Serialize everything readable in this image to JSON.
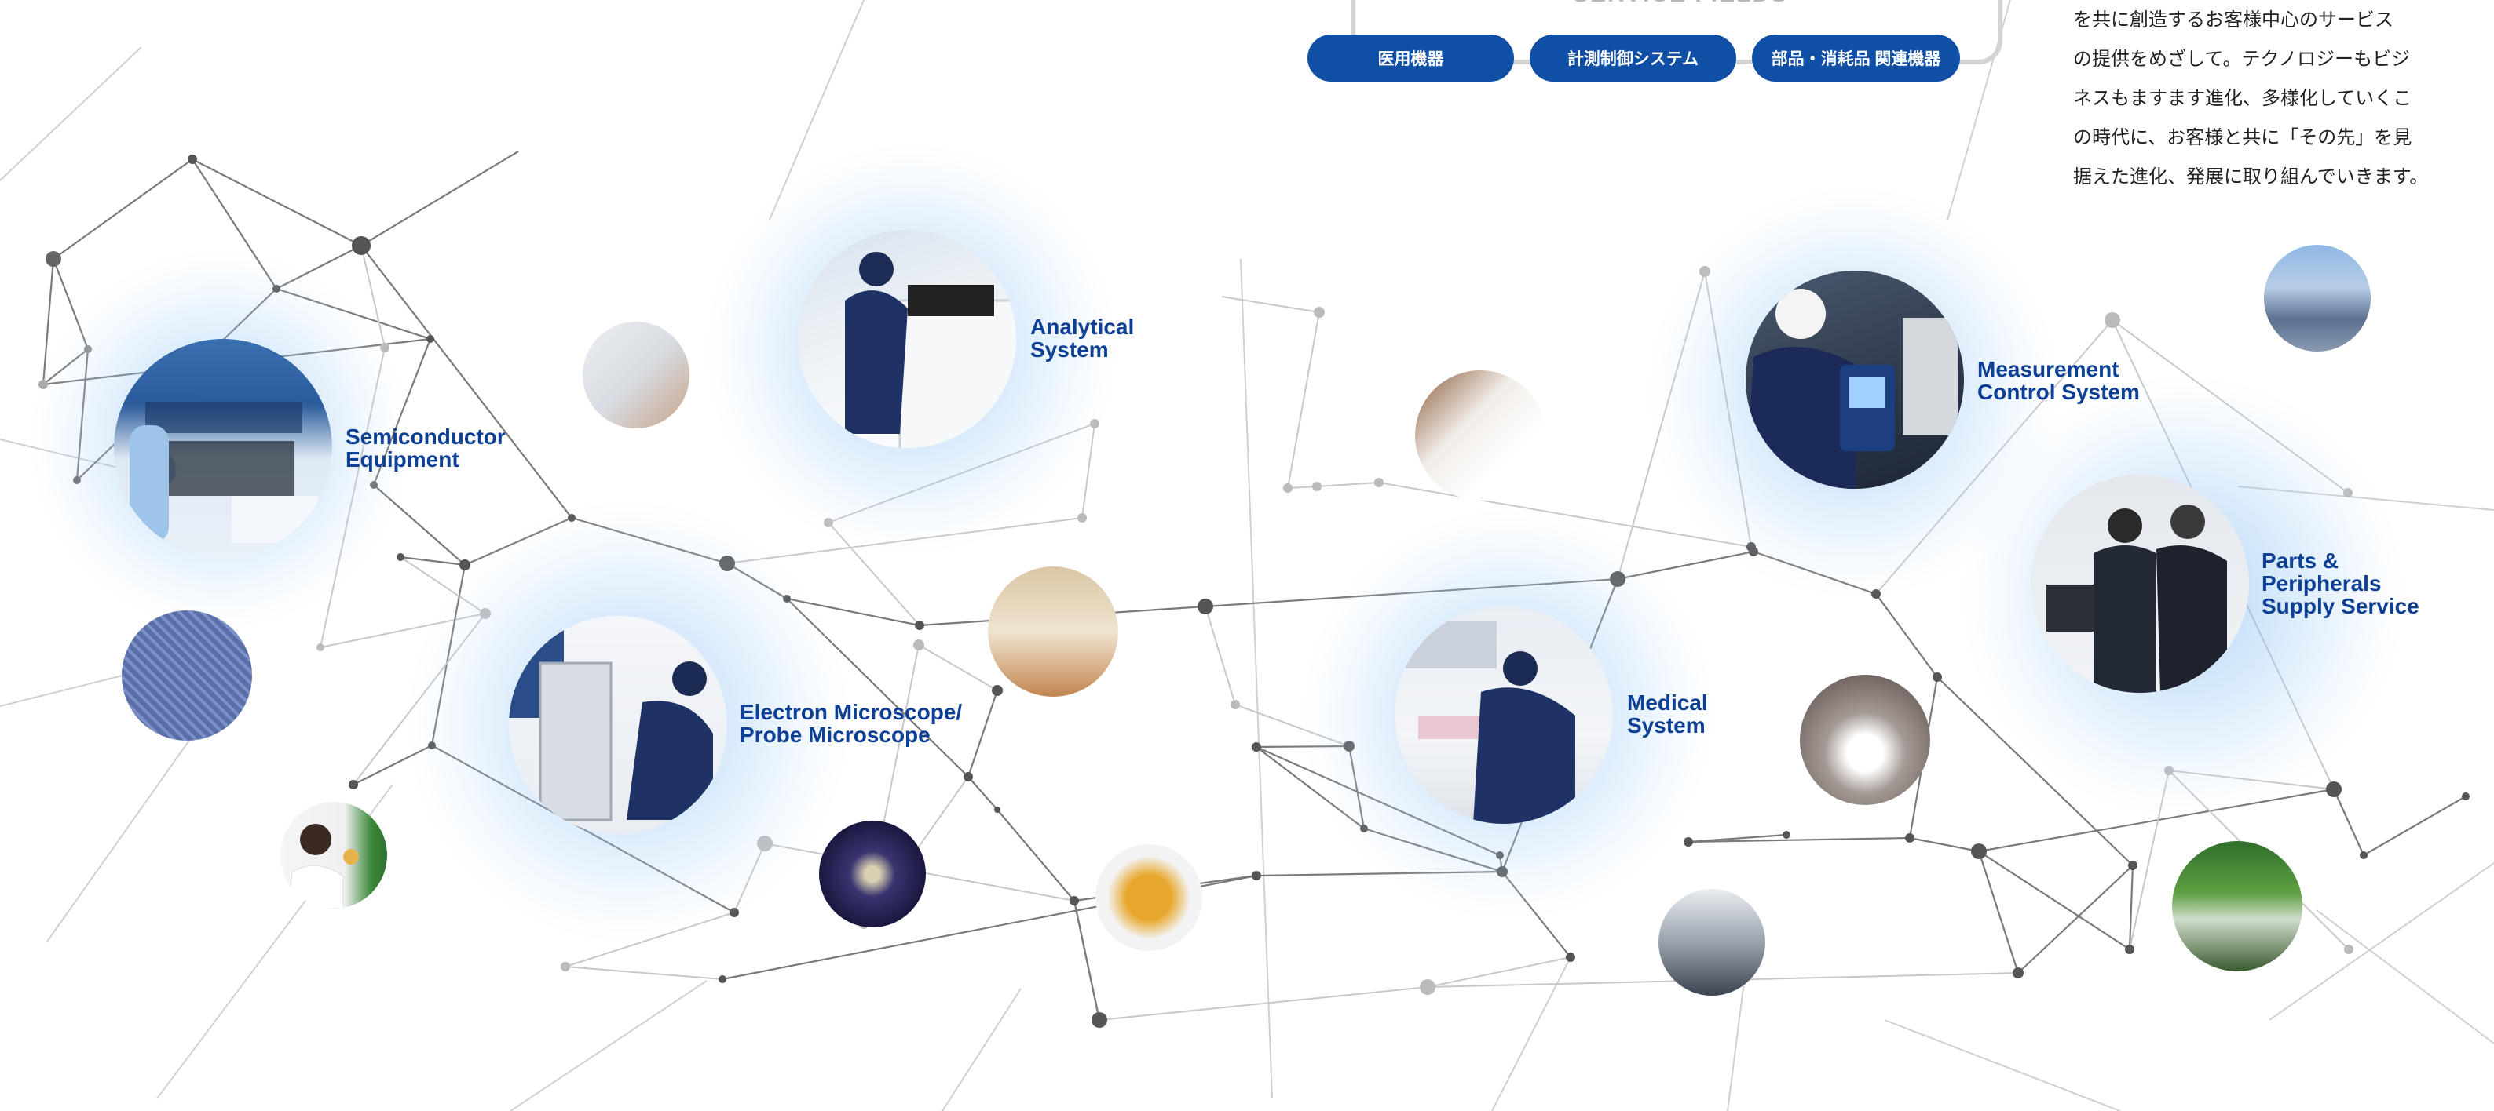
{
  "service_fields": {
    "title": "SERVICE FIELDS",
    "buttons": [
      "医用機器",
      "計測制御システム",
      "部品・消耗品 関連機器"
    ]
  },
  "intro_lines": [
    "を共に創造するお客様中心のサービス",
    "の提供をめざして。テクノロジーもビジ",
    "ネスもますます進化、多様化していくこ",
    "の時代に、お客様と共に「その先」を見",
    "据えた進化、発展に取り組んでいきます。"
  ],
  "categories": {
    "semiconductor": [
      "Semiconductor",
      "Equipment"
    ],
    "analytical": [
      "Analytical",
      "System"
    ],
    "electron": [
      "Electron Microscope/",
      "Probe Microscope"
    ],
    "measurement": [
      "Measurement",
      "Control System"
    ],
    "medical": [
      "Medical",
      "System"
    ],
    "parts": [
      "Parts &",
      "Peripherals",
      "Supply Service"
    ]
  },
  "colors": {
    "accent": "#0f4fa6",
    "label": "#0d3f94"
  }
}
